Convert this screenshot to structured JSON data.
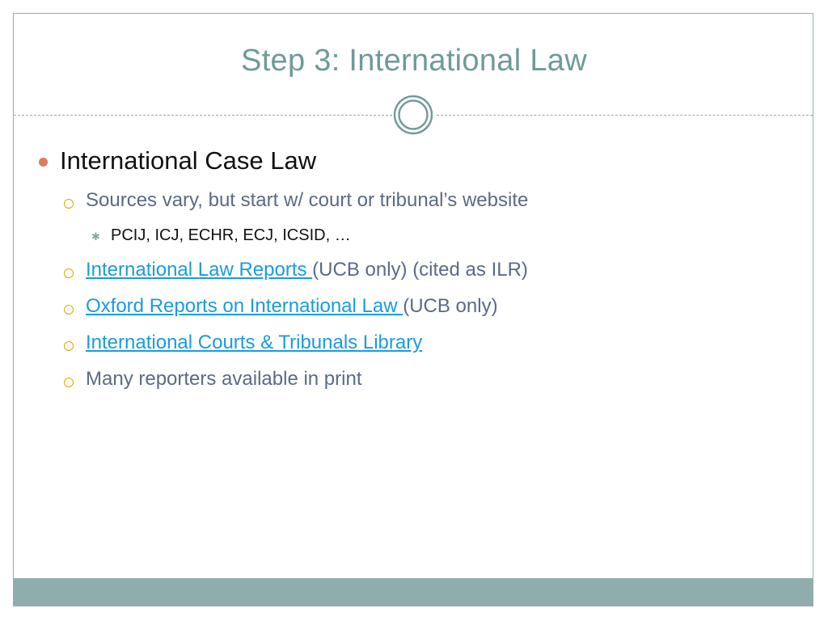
{
  "slide": {
    "title": "Step 3: International Law",
    "bullets": {
      "level1": "International Case Law",
      "sources": "Sources vary, but start w/ court or tribunal’s website",
      "courts": "PCIJ, ICJ, ECHR, ECJ, ICSID, …",
      "ilr_link": "International Law Reports ",
      "ilr_suffix": " (UCB only) (cited as ILR)",
      "oxford_link": "Oxford Reports on International Law ",
      "oxford_suffix": "(UCB only)",
      "courts_library_link": "International Courts & Tribunals Library",
      "print": "Many reporters available in print"
    }
  },
  "colors": {
    "accent": "#6f9a98",
    "footer": "#8fadac",
    "link": "#1a9be0",
    "bullet_l1": "#e07a5c",
    "bullet_l2": "#e0a800"
  },
  "icons": {
    "divider_ornament": "ring-icon",
    "level1_bullet": "filled-circle-icon",
    "level2_bullet": "hollow-circle-icon",
    "level3_bullet": "star-icon"
  }
}
